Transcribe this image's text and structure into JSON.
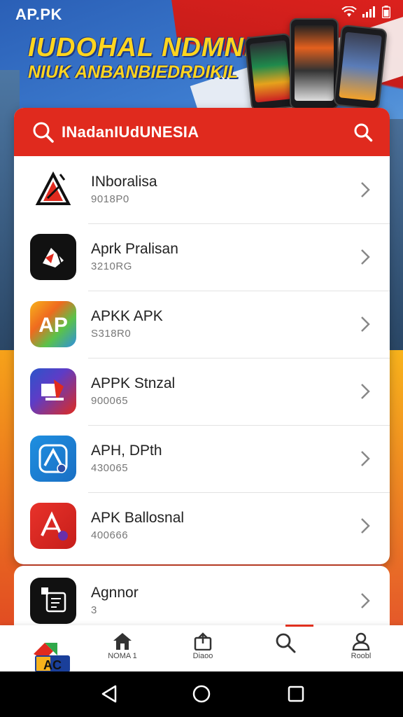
{
  "status_bar": {
    "title": "AP.PK"
  },
  "banner": {
    "headline_line1": "IUDOHAL NDMNI",
    "headline_line2": "NIUK ANBANBIEDRDIKIL"
  },
  "search": {
    "text": "INadanIUdUNESIA"
  },
  "apps": [
    {
      "name": "INboralisa",
      "sub": "9018P0"
    },
    {
      "name": "Aprk Pralisan",
      "sub": "3210RG"
    },
    {
      "name": "APKK APK",
      "sub": "S318R0"
    },
    {
      "name": "APPK Stnzal",
      "sub": "900065"
    },
    {
      "name": "APH, DPth",
      "sub": "430065"
    },
    {
      "name": "APK Ballosnal",
      "sub": "400666"
    }
  ],
  "extra_app": {
    "name": "Agnnor",
    "sub": "3"
  },
  "bottom_nav": {
    "items": [
      {
        "label": "NOMA 1",
        "icon": "home-icon"
      },
      {
        "label": "Diaoo",
        "icon": "upload-icon"
      },
      {
        "label": "",
        "icon": "search-icon"
      },
      {
        "label": "Roobl",
        "icon": "profile-icon"
      }
    ],
    "logo_text": "AC"
  },
  "colors": {
    "accent": "#e02a1e",
    "banner_blue": "#2a5fb6",
    "headline": "#ffd51f"
  }
}
